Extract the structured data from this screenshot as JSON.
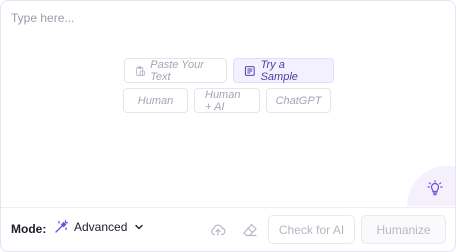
{
  "editor": {
    "placeholder": "Type here..."
  },
  "quick_actions": {
    "paste_label": "Paste Your Text",
    "sample_label": "Try a Sample"
  },
  "samples": [
    "Human",
    "Human + AI",
    "ChatGPT"
  ],
  "footer": {
    "mode_label": "Mode:",
    "mode_value": "Advanced",
    "check_label": "Check for AI",
    "humanize_label": "Humanize"
  },
  "colors": {
    "accent": "#6b4ce6",
    "sample_bg": "#f3f0ff",
    "bulb_bg": "#f4f1fd"
  },
  "icons": [
    "clipboard-icon",
    "document-icon",
    "lightbulb-icon",
    "magic-wand-icon",
    "chevron-down-icon",
    "cloud-upload-icon",
    "eraser-icon"
  ]
}
